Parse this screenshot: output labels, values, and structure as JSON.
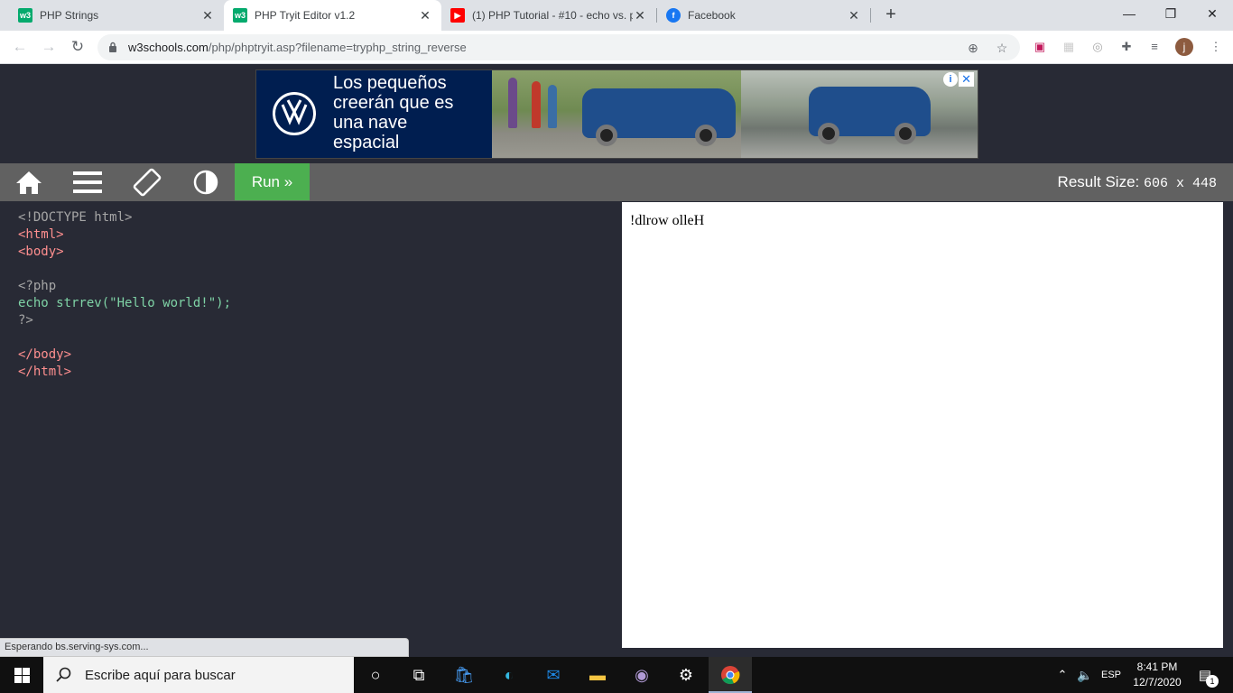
{
  "browser": {
    "tabs": [
      {
        "title": "PHP Strings",
        "favicon": "w3schools-icon",
        "active": false
      },
      {
        "title": "PHP Tryit Editor v1.2",
        "favicon": "w3schools-icon",
        "active": true
      },
      {
        "title": "(1) PHP Tutorial - #10 - echo vs. p",
        "favicon": "youtube-icon",
        "active": false
      },
      {
        "title": "Facebook",
        "favicon": "facebook-icon",
        "active": false
      }
    ],
    "url_host": "w3schools.com",
    "url_path": "/php/phptryit.asp?filename=tryphp_string_reverse",
    "profile_initial": "j",
    "status_text": "Esperando bs.serving-sys.com..."
  },
  "ad": {
    "headline": "Los pequeños creerán que es una nave espacial",
    "brand_icon": "volkswagen-logo"
  },
  "editor": {
    "run_label": "Run »",
    "result_size_label": "Result Size:",
    "result_size_value": "606 x 448",
    "code_lines": [
      "<!DOCTYPE html>",
      "<html>",
      "<body>",
      "",
      "<?php",
      "echo strrev(\"Hello world!\");",
      "?>",
      "",
      "</body>",
      "</html>"
    ],
    "output": "!dlrow olleH"
  },
  "taskbar": {
    "search_placeholder": "Escribe aquí para buscar",
    "language": "ESP",
    "time": "8:41 PM",
    "date": "12/7/2020",
    "notification_count": "1"
  },
  "colors": {
    "run_green": "#4caf50",
    "editor_bg": "#282a35",
    "toolbar_gray": "#616161"
  }
}
